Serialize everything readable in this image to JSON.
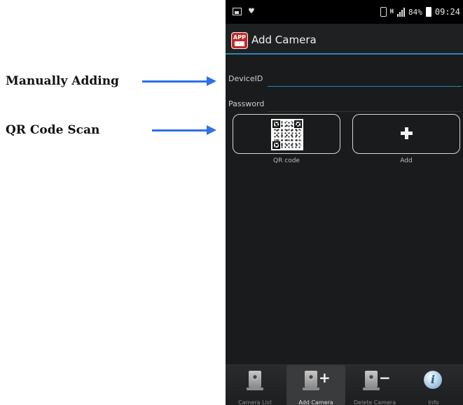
{
  "annotations": {
    "manual": "Manually Adding",
    "qr": "QR Code Scan"
  },
  "status_bar": {
    "battery": "84%",
    "time": "09:24",
    "network": "H"
  },
  "action_bar": {
    "app_icon_text": "APP",
    "title": "Add Camera"
  },
  "form": {
    "device_id_label": "DeviceID",
    "device_id_value": "",
    "password_label": "Password",
    "password_value": ""
  },
  "tiles": {
    "qr_label": "QR code",
    "add_label": "Add"
  },
  "tab_bar": {
    "tabs": [
      {
        "label": "Camera List",
        "icon": "camera-icon"
      },
      {
        "label": "Add Camera",
        "icon": "camera-add-icon",
        "active": true
      },
      {
        "label": "Delete Camera",
        "icon": "camera-delete-icon"
      },
      {
        "label": "Info",
        "icon": "info-icon"
      }
    ]
  },
  "colors": {
    "accent": "#2c86b8",
    "annotation_arrow": "#2f6fe8",
    "background": "#1a1b1d"
  }
}
